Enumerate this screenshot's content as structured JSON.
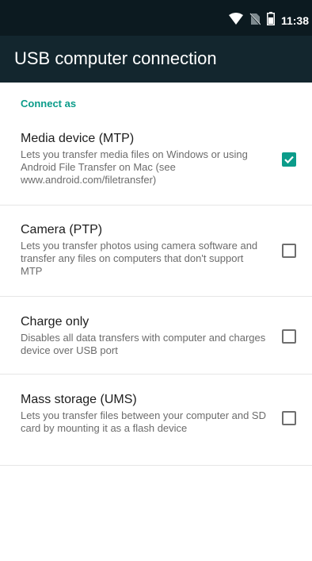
{
  "status_bar": {
    "time": "11:38",
    "icons": [
      "wifi-icon",
      "no-sim-icon",
      "battery-icon"
    ]
  },
  "app_bar": {
    "title": "USB computer connection"
  },
  "section": {
    "header": "Connect as"
  },
  "options": [
    {
      "title": "Media device (MTP)",
      "description": "Lets you transfer media files on Windows or using Android File Transfer on Mac (see www.android.com/filetransfer)",
      "checked": true
    },
    {
      "title": "Camera (PTP)",
      "description": "Lets you transfer photos using camera software and transfer any files on computers that don't support MTP",
      "checked": false
    },
    {
      "title": "Charge only",
      "description": "Disables all data transfers with computer and charges device over USB port",
      "checked": false
    },
    {
      "title": "Mass storage (UMS)",
      "description": "Lets you transfer files between your computer and SD card by mounting it as a flash device",
      "checked": false
    }
  ],
  "colors": {
    "accent": "#0b9c8a",
    "status_bar": "#0c1a20",
    "app_bar": "#13262e"
  }
}
